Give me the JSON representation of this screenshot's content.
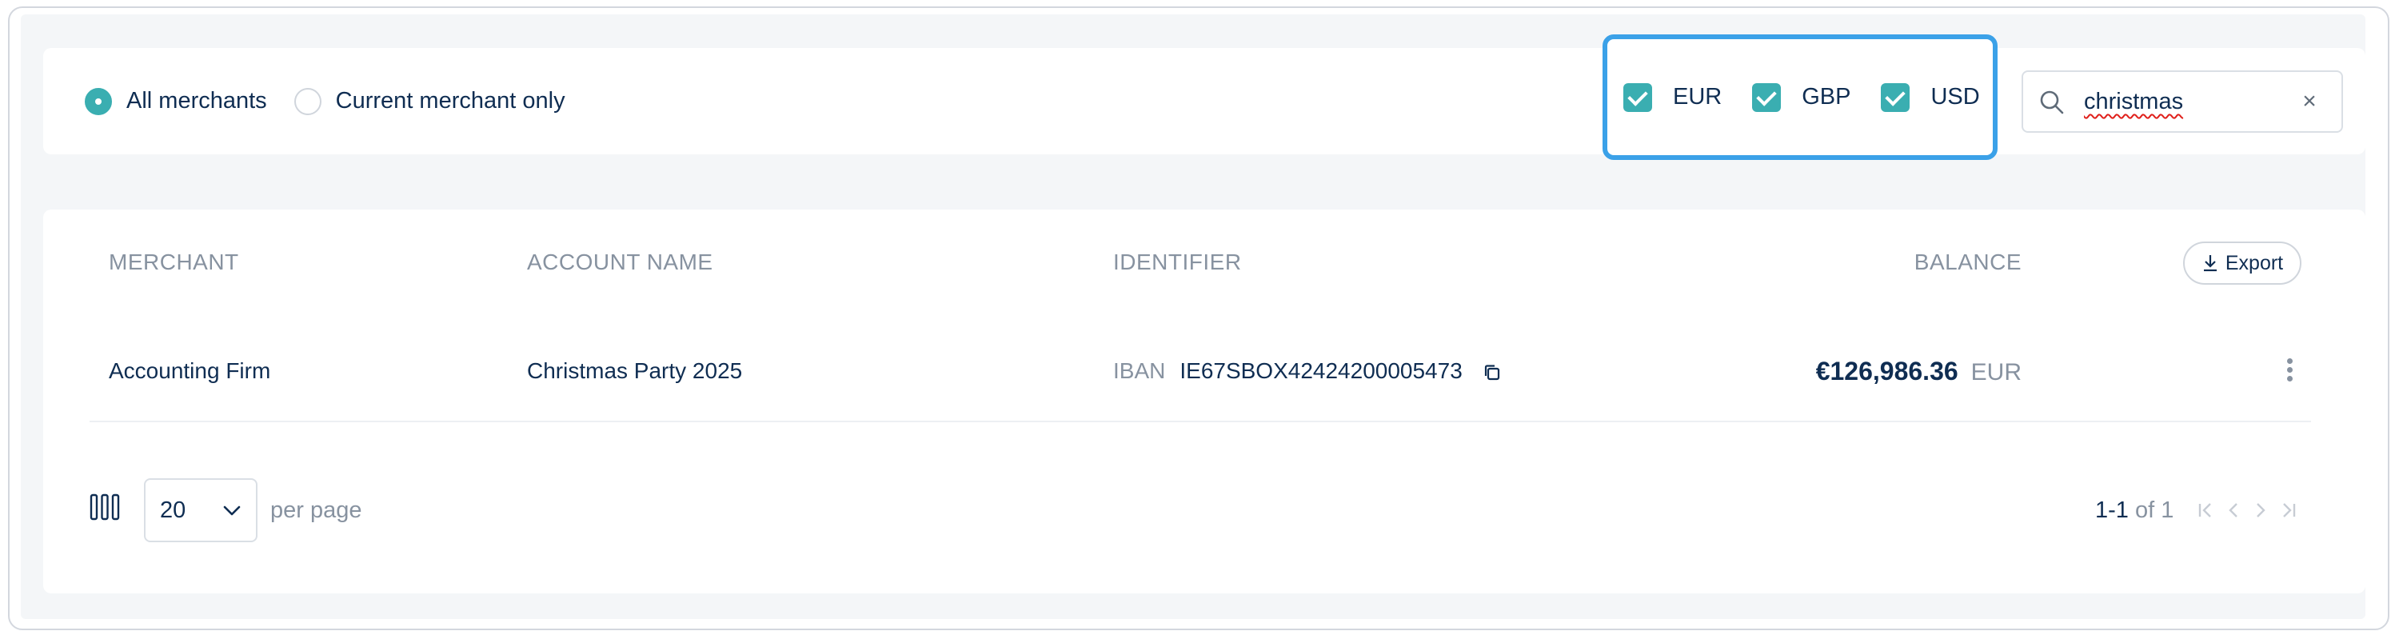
{
  "filters": {
    "scope": [
      {
        "label": "All merchants",
        "checked": true
      },
      {
        "label": "Current merchant only",
        "checked": false
      }
    ],
    "currencies": [
      {
        "label": "EUR",
        "checked": true
      },
      {
        "label": "GBP",
        "checked": true
      },
      {
        "label": "USD",
        "checked": true
      }
    ],
    "search": {
      "value": "christmas",
      "icon": "search-icon",
      "clear_icon": "close-icon"
    }
  },
  "table": {
    "headers": {
      "merchant": "MERCHANT",
      "account_name": "ACCOUNT NAME",
      "identifier": "IDENTIFIER",
      "balance": "BALANCE"
    },
    "export_label": "Export",
    "rows": [
      {
        "merchant": "Accounting Firm",
        "account_name": "Christmas Party 2025",
        "identifier_type": "IBAN",
        "identifier": "IE67SBOX42424200005473",
        "balance_amount": "€126,986.36",
        "balance_currency": "EUR"
      }
    ]
  },
  "footer": {
    "page_size": "20",
    "per_page_label": "per page",
    "range": "1-1",
    "of_label": "of",
    "total": "1"
  },
  "colors": {
    "accent": "#3aaeb1",
    "highlight_border": "#3ba1e8",
    "text_primary": "#0f2d52",
    "text_muted": "#8792a0"
  }
}
